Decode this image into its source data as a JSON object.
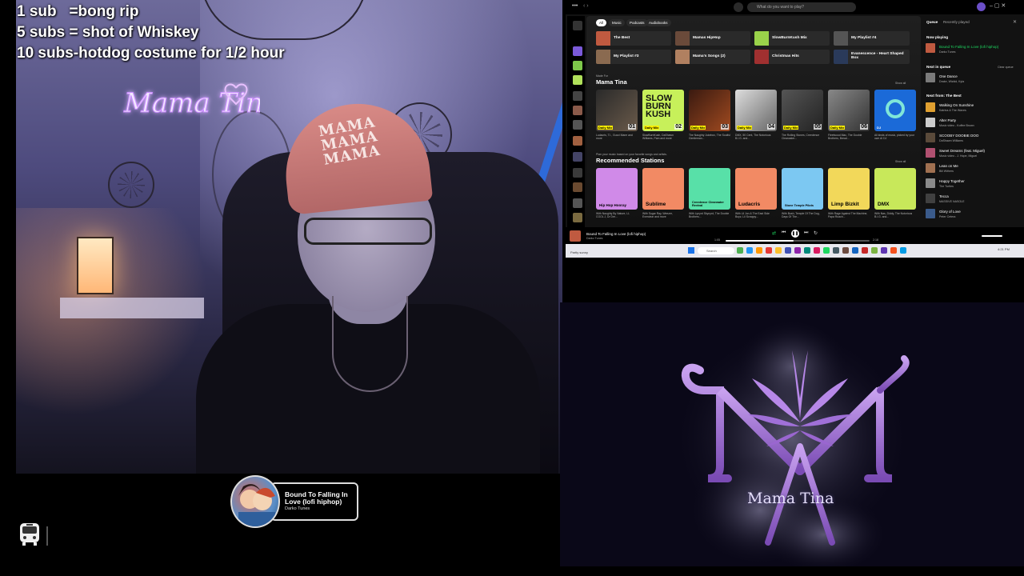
{
  "overlay": {
    "goals": [
      "1 sub   =bong rip",
      "5 subs = shot of Whiskey",
      "10 subs-hotdog costume for 1/2 hour"
    ]
  },
  "webcam": {
    "neon_sign": "Mama Tina",
    "cap_lines": [
      "MAMA",
      "MAMA",
      "MAMA"
    ]
  },
  "now_playing_widget": {
    "title": "Bound To Falling In Love (lofi hiphop)",
    "artist": "Darko Tunes"
  },
  "spotify": {
    "search_placeholder": "What do you want to play?",
    "filter_chips": [
      "All",
      "Music",
      "Podcasts",
      "Audiobooks"
    ],
    "quick_tiles": [
      "The Best",
      "Mamas HipHop",
      "SlowBurnKush Mix",
      "My Playlist #4",
      "My Playlist #3",
      "Mama's Songs (2)",
      "Christmas Hits",
      "Evanescence - Heart Shaped Box"
    ],
    "made_for": {
      "kicker": "Made For",
      "title": "Mama Tina",
      "show_all": "Show all",
      "cards": [
        {
          "badge": "Daily Mix",
          "num": "01",
          "caption": "Ludacris, T.I., Gucci Mane and more"
        },
        {
          "badge": "Daily Mix",
          "num": "02",
          "caption": "SlowBurnKush, DaShawn Williams, Pam and more"
        },
        {
          "badge": "Daily Mix",
          "num": "03",
          "caption": "The Naughty Jukebox, The Soulful Gentleman..."
        },
        {
          "badge": "Daily Mix",
          "num": "04",
          "caption": "DMX, 50 Cent, The Notorious B.I.G. and..."
        },
        {
          "badge": "Daily Mix",
          "num": "05",
          "caption": "The Rolling Stones, Creedence Clearwater..."
        },
        {
          "badge": "Daily Mix",
          "num": "06",
          "caption": "Fleetwood Mac, The Doobie Brothers, Bread..."
        },
        {
          "badge": "DJ",
          "num": "",
          "caption": "All kinds of music, picked by your own AI DJ"
        }
      ]
    },
    "stations": {
      "kicker": "Plan your music based on your favorite songs and artists.",
      "title": "Recommended Stations",
      "show_all": "Show all",
      "items": [
        {
          "name": "Hip Hop Hooray",
          "caption": "With Naughty By Nature, LL COOL J, Dr Dre..."
        },
        {
          "name": "Sublime",
          "caption": "With Sugar Ray, Weezer, Everclear and more"
        },
        {
          "name": "Creedence Clearwater Revival",
          "caption": "With Lynyrd Skynyrd, The Doobie Brothers..."
        },
        {
          "name": "Ludacris",
          "caption": "With Lil Jon & The East Side Boyz, Lil Scrappy..."
        },
        {
          "name": "Stone Temple Pilots",
          "caption": "With Bush, Temple Of The Dog, Days Of The..."
        },
        {
          "name": "Limp Bizkit",
          "caption": "With Rage Against The Machine, Papa Roach..."
        },
        {
          "name": "DMX",
          "caption": "With Nas, Diddy, The Notorious B.I.G. and..."
        }
      ]
    },
    "queue": {
      "tab_queue": "Queue",
      "tab_recent": "Recently played",
      "now_playing_label": "Now playing",
      "now_title": "Bound To Falling In Love (lofi hiphop)",
      "now_artist": "Darko Tunes",
      "next_queue_label": "Next in queue",
      "clear_label": "Clear queue",
      "next_queue": [
        {
          "title": "One Dance",
          "artist": "Drake, Wizkid, Kyla"
        }
      ],
      "next_from_label": "Next from: The Best",
      "next_from": [
        {
          "title": "Walking On Sunshine",
          "artist": "Katrina & The Waves"
        },
        {
          "title": "Alter Party",
          "artist": "Music video - Koffee Brown"
        },
        {
          "title": "SCOOBY DOOBIE DOO",
          "artist": "DaShawn Williams"
        },
        {
          "title": "Sweet Dreams (feat. Miguel)",
          "artist": "Music video - J. Hope, Miguel"
        },
        {
          "title": "Lean on Me",
          "artist": "Bill Withers"
        },
        {
          "title": "Happy Together",
          "artist": "The Turtles"
        },
        {
          "title": "Tecca",
          "artist": "MASSIVE NASOLE"
        },
        {
          "title": "Glory of Love",
          "artist": "Peter Cetera"
        }
      ]
    },
    "player": {
      "track": "Bound To Falling In Love (lofi hiphop)",
      "artist": "Darko Tunes",
      "elapsed": "1:05",
      "duration": "2:18",
      "progress": 0.47
    },
    "taskbar": {
      "search_placeholder": "Search",
      "weather": "Partly sunny",
      "time": "4:21 PM"
    }
  },
  "logo": {
    "name": "Mama Tina",
    "colors": {
      "purple": "#a579d6",
      "leaf": "#b788e8",
      "smoke": "#8f8aa8"
    }
  }
}
